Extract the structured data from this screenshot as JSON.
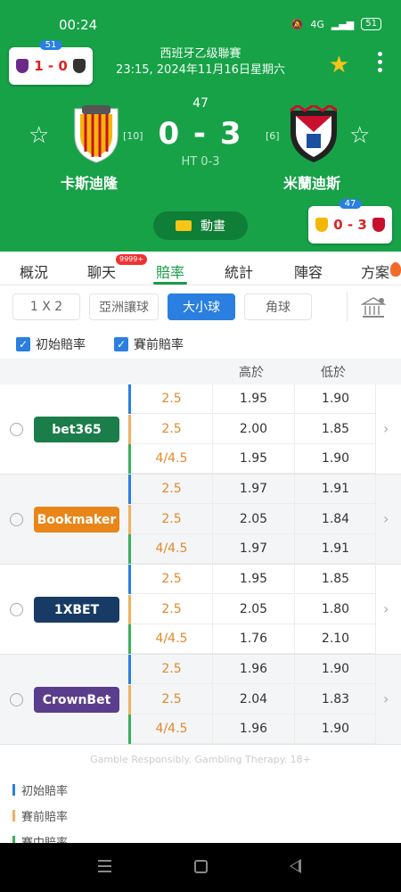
{
  "status_bar": {
    "time": "00:24",
    "network": "4G",
    "battery": "51"
  },
  "header": {
    "league": "西班牙乙级聯賽",
    "datetime": "23:15, 2024年11月16日星期六",
    "minute": "47",
    "score": "0 - 3",
    "halftime": "HT 0-3",
    "home": {
      "name": "卡斯迪隆",
      "rank": "[10]",
      "color": "#f2b705"
    },
    "away": {
      "name": "米蘭迪斯",
      "rank": "[6]",
      "color": "#c8102e"
    },
    "animation_label": "動畫",
    "mini_left": {
      "badge": "51",
      "score": "1 - 0"
    },
    "mini_right": {
      "badge": "47",
      "score": "0 - 3"
    }
  },
  "tabs": [
    {
      "label": "概況"
    },
    {
      "label": "聊天",
      "badge": "9999+"
    },
    {
      "label": "賠率",
      "active": true
    },
    {
      "label": "統計"
    },
    {
      "label": "陣容"
    },
    {
      "label": "方案"
    }
  ],
  "filters": [
    {
      "label": "1 X 2"
    },
    {
      "label": "亞洲讓球"
    },
    {
      "label": "大小球",
      "active": true
    },
    {
      "label": "角球"
    }
  ],
  "checks": [
    {
      "label": "初始賠率",
      "checked": true
    },
    {
      "label": "賽前賠率",
      "checked": true
    }
  ],
  "table_header": {
    "over": "高於",
    "under": "低於"
  },
  "bookmakers": [
    {
      "name": "bet365",
      "color": "#1b7d4a",
      "rows": [
        {
          "line": "2.5",
          "over": "1.95",
          "under": "1.90"
        },
        {
          "line": "2.5",
          "over": "2.00",
          "under": "1.85"
        },
        {
          "line": "4/4.5",
          "over": "1.95",
          "under": "1.90"
        }
      ]
    },
    {
      "name": "Bookmaker",
      "color": "#e8861a",
      "rows": [
        {
          "line": "2.5",
          "over": "1.97",
          "under": "1.91"
        },
        {
          "line": "2.5",
          "over": "2.05",
          "under": "1.84"
        },
        {
          "line": "4/4.5",
          "over": "1.97",
          "under": "1.91"
        }
      ]
    },
    {
      "name": "1XBET",
      "color": "#173b64",
      "rows": [
        {
          "line": "2.5",
          "over": "1.95",
          "under": "1.85"
        },
        {
          "line": "2.5",
          "over": "2.05",
          "under": "1.80"
        },
        {
          "line": "4/4.5",
          "over": "1.76",
          "under": "2.10"
        }
      ]
    },
    {
      "name": "CrownBet",
      "color": "#5a3d8c",
      "rows": [
        {
          "line": "2.5",
          "over": "1.96",
          "under": "1.90"
        },
        {
          "line": "2.5",
          "over": "2.04",
          "under": "1.83"
        },
        {
          "line": "4/4.5",
          "over": "1.96",
          "under": "1.90"
        }
      ]
    }
  ],
  "disclaimer": "Gamble Responsibly. Gambling Therapy. 18+",
  "legend": [
    {
      "label": "初始賠率",
      "color": "#2a7fe0"
    },
    {
      "label": "賽前賠率",
      "color": "#f0b060"
    },
    {
      "label": "賽中賠率",
      "color": "#3ab05a"
    }
  ]
}
